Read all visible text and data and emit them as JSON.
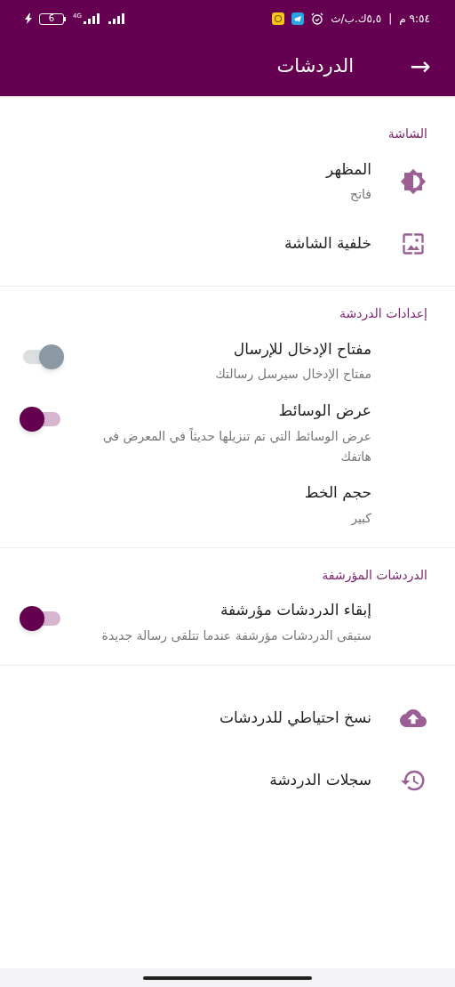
{
  "status_bar": {
    "time": "٩:٥٤ م",
    "separator": "|",
    "speed": "٥,٥ك.ب/ث",
    "network": "4G",
    "battery": "6"
  },
  "app_bar": {
    "title": "الدردشات",
    "back": "→"
  },
  "sections": [
    {
      "title": "الشاشة",
      "items": [
        {
          "kind": "icon",
          "title": "المظهر",
          "subtitle": "فاتح"
        },
        {
          "kind": "icon",
          "title": "خلفية الشاشة"
        }
      ]
    },
    {
      "title": "إعدادات الدردشة",
      "items": [
        {
          "kind": "toggle",
          "title": "مفتاح الإدخال للإرسال",
          "subtitle": "مفتاح الإدخال سيرسل رسالتك",
          "on": false
        },
        {
          "kind": "toggle",
          "title": "عرض الوسائط",
          "subtitle": "عرض الوسائط التي تم تنزيلها حديثاً في المعرض في هاتفك",
          "on": true
        },
        {
          "kind": "plain",
          "title": "حجم الخط",
          "subtitle": "كبير"
        }
      ]
    },
    {
      "title": "الدردشات المؤرشفة",
      "items": [
        {
          "kind": "toggle",
          "title": "إبقاء الدردشات مؤرشفة",
          "subtitle": "ستبقى الدردشات مؤرشفة عندما تتلقى رسالة جديدة",
          "on": true
        }
      ]
    },
    {
      "items": [
        {
          "kind": "icon",
          "title": "نسخ احتياطي للدردشات"
        },
        {
          "kind": "icon",
          "title": "سجلات الدردشة"
        }
      ]
    }
  ]
}
